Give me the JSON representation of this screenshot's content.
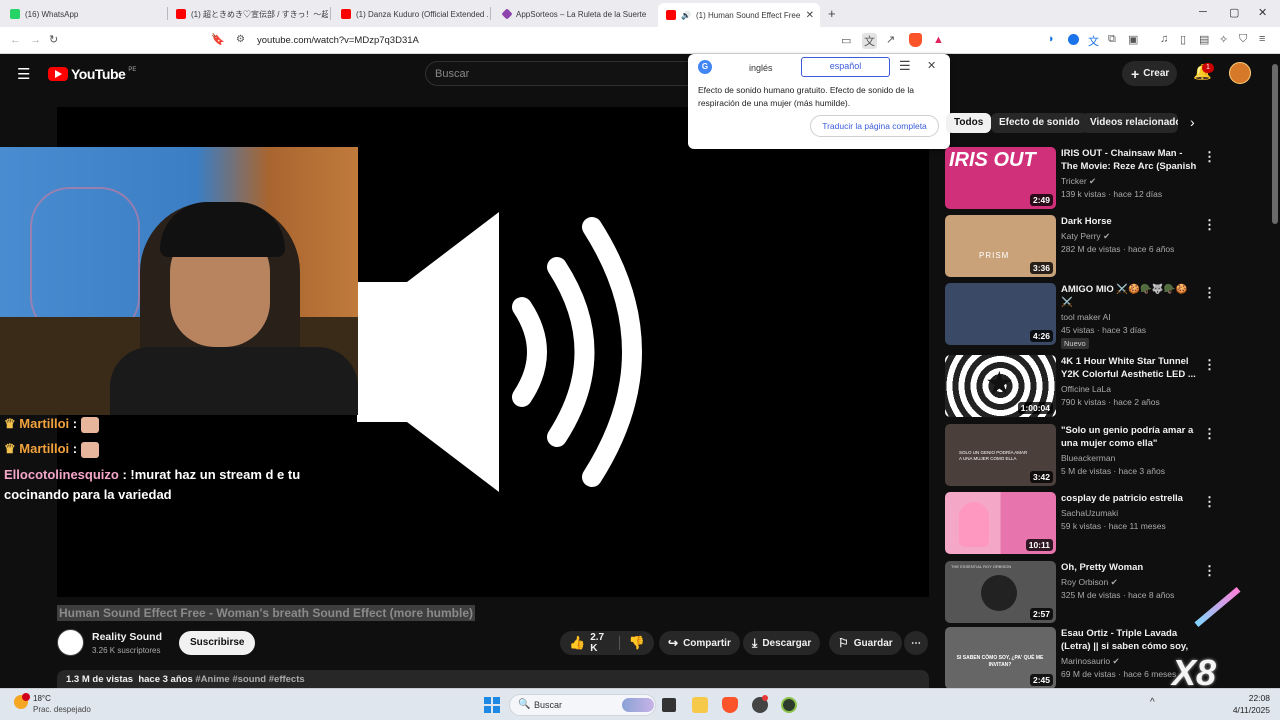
{
  "browser": {
    "tabs": [
      {
        "label": "(16) WhatsApp",
        "color": "#25d366"
      },
      {
        "label": "(1) 超ときめき♡宣伝部 / すきっ！〜超ver...",
        "color": "#ff0000"
      },
      {
        "label": "(1) Danza Kuduro (Official Extended ...",
        "color": "#ff0000"
      },
      {
        "label": "AppSorteos – La Ruleta de la Suerte",
        "color": "#8e44ad"
      },
      {
        "label": "(1) Human Sound Effect Free",
        "color": "#ff0000"
      }
    ],
    "url": "youtube.com/watch?v=MDzp7q3D31A"
  },
  "youtube": {
    "logo": "YouTube",
    "region": "PE",
    "search_placeholder": "Buscar",
    "create_label": "Crear",
    "notif_count": "1"
  },
  "translate": {
    "lang_from": "inglés",
    "lang_to": "español",
    "text": "Efecto de sonido humano gratuito. Efecto de sonido de la respiración de una mujer (más humilde).",
    "full_page": "Traducir la página completa"
  },
  "chat": [
    {
      "user": "Martilloi",
      "msg": ""
    },
    {
      "user": "Martilloi",
      "msg": ""
    },
    {
      "user": "Ellocotolinesquizo",
      "msg": "!murat haz un stream d e tu cocinando para la variedad"
    }
  ],
  "video": {
    "title": "Human Sound Effect Free - Woman's breath Sound Effect (more humble)",
    "channel": "Reality Sound",
    "subs": "3.26 K suscriptores",
    "subscribe": "Suscribirse",
    "likes": "2.7 K",
    "share": "Compartir",
    "download": "Descargar",
    "save": "Guardar",
    "views": "1.3 M de vistas",
    "ago": "hace 3 años",
    "tags": "#Anime #sound #effects"
  },
  "chips": [
    "Todos",
    "Efecto de sonido",
    "Videos relacionados"
  ],
  "recs": [
    {
      "title": "IRIS OUT - Chainsaw Man - The Movie: Reze Arc (Spanish Cov...",
      "channel": "Tricker",
      "meta": "139 k vistas · hace 12 días",
      "dur": "2:49",
      "thumb": "#d0307a",
      "thumb_text": "IRIS OUT"
    },
    {
      "title": "Dark Horse",
      "channel": "Katy Perry",
      "meta": "282 M de vistas · hace 6 años",
      "dur": "3:36",
      "thumb": "#c9a27a",
      "thumb_text": "PRISM"
    },
    {
      "title": "AMIGO MIO ⚔️🍪🪖🐺🪖🍪 ⚔️",
      "channel": "tool maker AI",
      "meta": "45 vistas · hace 3 días",
      "dur": "4:26",
      "thumb": "#3a4a66",
      "badge": "Nuevo",
      "thumb_text": ""
    },
    {
      "title": "4K 1 Hour White Star Tunnel Y2K Colorful Aesthetic LED ...",
      "channel": "Officine LaLa",
      "meta": "790 k vistas · hace 2 años",
      "dur": "1:00:04",
      "thumb": "#777777",
      "thumb_text": "★"
    },
    {
      "title": "\"Solo un genio podría amar a una mujer como ella\"",
      "channel": "Blueackerman",
      "meta": "5 M de vistas · hace 3 años",
      "dur": "3:42",
      "thumb": "#4a3f3a",
      "thumb_text": "SOLO UN GENIO PODRÍA AMAR A UNA MUJER COMO ELLA"
    },
    {
      "title": "cosplay de patricio estrella",
      "channel": "SachaUzumaki",
      "meta": "59 k vistas · hace 11 meses",
      "dur": "10:11",
      "thumb": "#e88fb8",
      "thumb_text": ""
    },
    {
      "title": "Oh, Pretty Woman",
      "channel": "Roy Orbison",
      "meta": "325 M de vistas · hace 8 años",
      "dur": "2:57",
      "thumb": "#555555",
      "thumb_text": "THE ESSENTIAL ROY ORBISON"
    },
    {
      "title": "Esau Ortiz - Triple Lavada (Letra) || si saben cómo soy, ¿...",
      "channel": "Marinosaurio",
      "meta": "69 M de vistas · hace 6 meses",
      "dur": "2:45",
      "thumb": "#666666",
      "thumb_text": "SI SABEN CÓMO SOY, ¿PA' QUÉ ME INVITAN?"
    }
  ],
  "overlay_x8": "X8",
  "taskbar": {
    "temp": "18°C",
    "weather": "Prac. despejado",
    "search": "Buscar",
    "time": "22:08",
    "date": "4/11/2025"
  }
}
